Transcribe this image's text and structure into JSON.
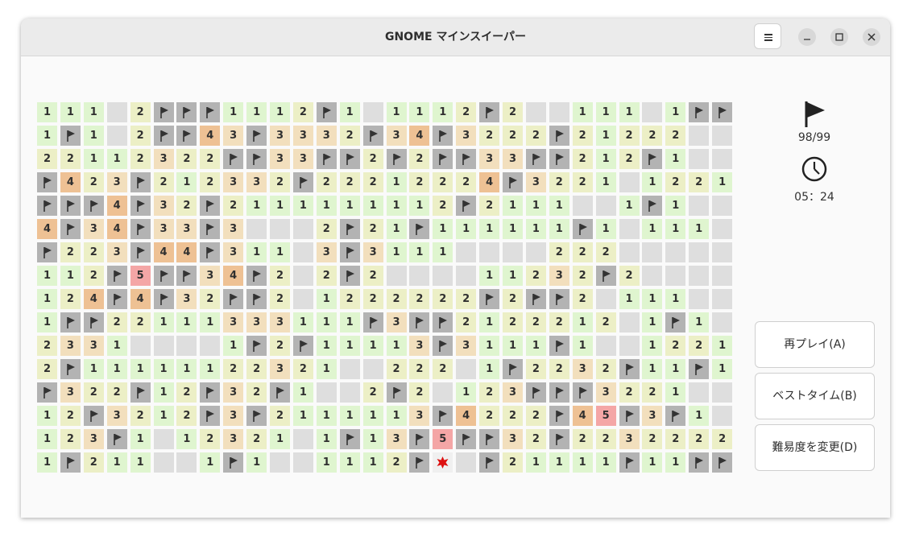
{
  "window": {
    "title": "GNOME マインスイーパー"
  },
  "status": {
    "flags": "98/99",
    "time": "05：24"
  },
  "buttons": {
    "replay": "再プレイ(A)",
    "best_times": "ベストタイム(B)",
    "change_difficulty": "難易度を変更(D)"
  },
  "colors": {
    "n1": "#dff5cf",
    "n2": "#ecefc6",
    "n3": "#f2dfbd",
    "n4": "#eec194",
    "n5": "#f4a6a6",
    "unrevealed": "#dedede",
    "flag": "#b3b3b3",
    "mine": "#f0f0f0"
  },
  "board": {
    "columns": 30,
    "rows": [
      "111.2FFF1112F1.1112F2..111.1FF",
      "1F1.2FF43F3332F34F3222F21222",
      "22112322FF33FF2F2FF33FF212F1..",
      "F423F212332F22212224F3221.1221.",
      "FFF4F32F2111111112F2111..1F1.",
      "4F34F33F3...2F21F111111F1.111.",
      "F223F44F311.3F3111....222.....",
      "112F5FF34F2.2F2....11232F2.....",
      "124F4F32FF2.1222222F2FF2.111.",
      "1FF22111333111F3FF2122212.1F1.",
      "2331....1F2F11113F3111F1..1221.",
      "2F11111122321..222.1F2232F11F1.",
      "F322F12F32F1..2F2.123FFF3221.",
      "12F3212F3F2111113F4222F45F3F1..",
      "123F1.1232 1.1F13F5FF32F22322222",
      "1F211..1F1..1112F*.F21111F11FF"
    ]
  }
}
